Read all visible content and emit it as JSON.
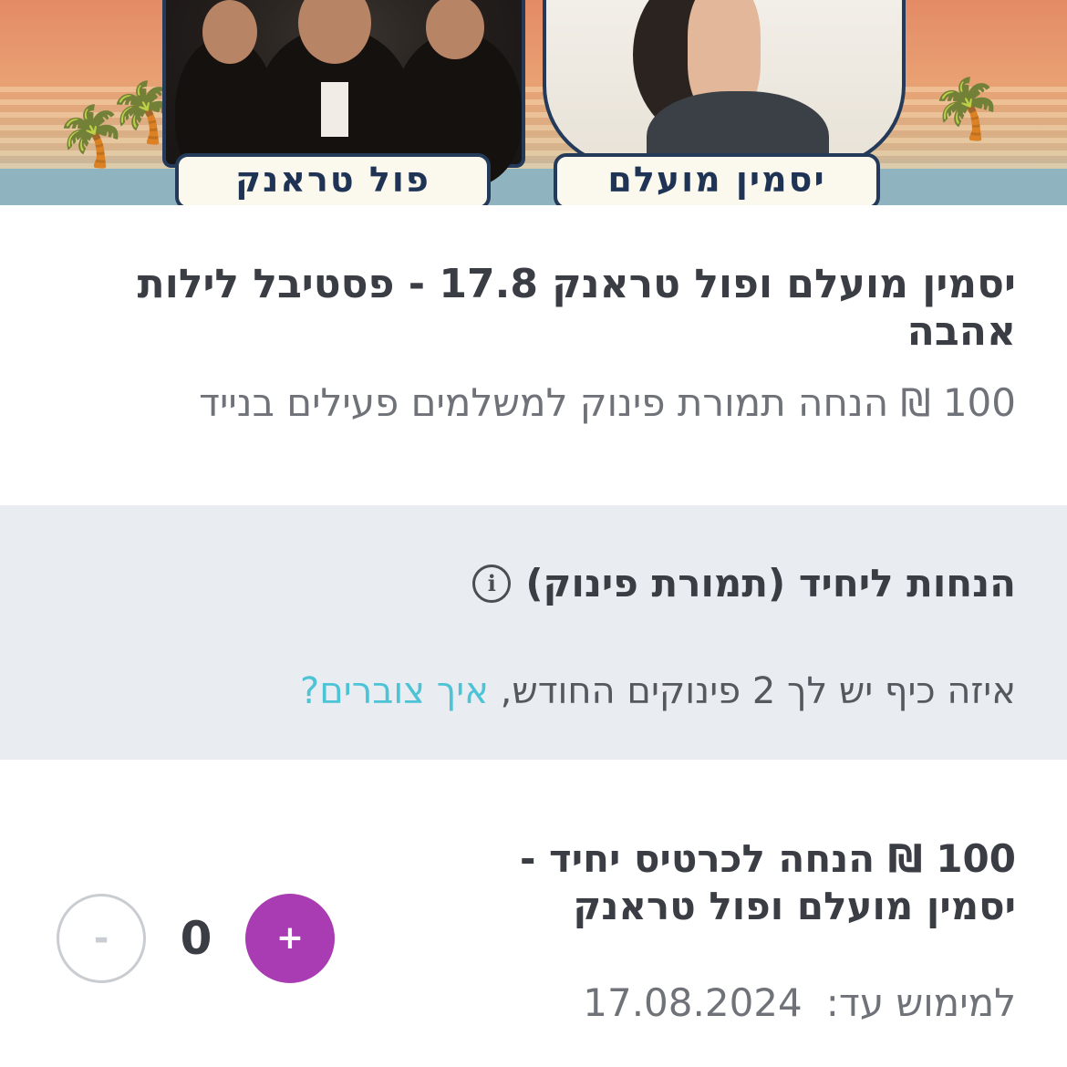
{
  "banner": {
    "artist_left_label": "פול טראנק",
    "artist_right_label": "יסמין מועלם"
  },
  "event": {
    "title": "יסמין מועלם ופול טראנק 17.8 - פסטיבל לילות אהבה",
    "subtitle": "100 ₪ הנחה תמורת פינוק למשלמים פעילים בנייד"
  },
  "info_panel": {
    "heading": "הנחות ליחיד (תמורת פינוק)",
    "info_icon": "i",
    "text_prefix": "איזה כיף יש לך 2 פינוקים החודש, ",
    "link_text": "איך צוברים?"
  },
  "offer": {
    "title": "100 ₪ הנחה לכרטיס יחיד - יסמין מועלם ופול טראנק",
    "expiry_label": "למימוש עד:",
    "expiry_date": "17.08.2024",
    "quantity": "0",
    "minus_label": "-",
    "plus_label": "+"
  },
  "colors": {
    "accent_plus": "#a93bb3",
    "link": "#4dc3d6",
    "panel_bg": "#e9ecf0",
    "text": "#3a3d44"
  }
}
